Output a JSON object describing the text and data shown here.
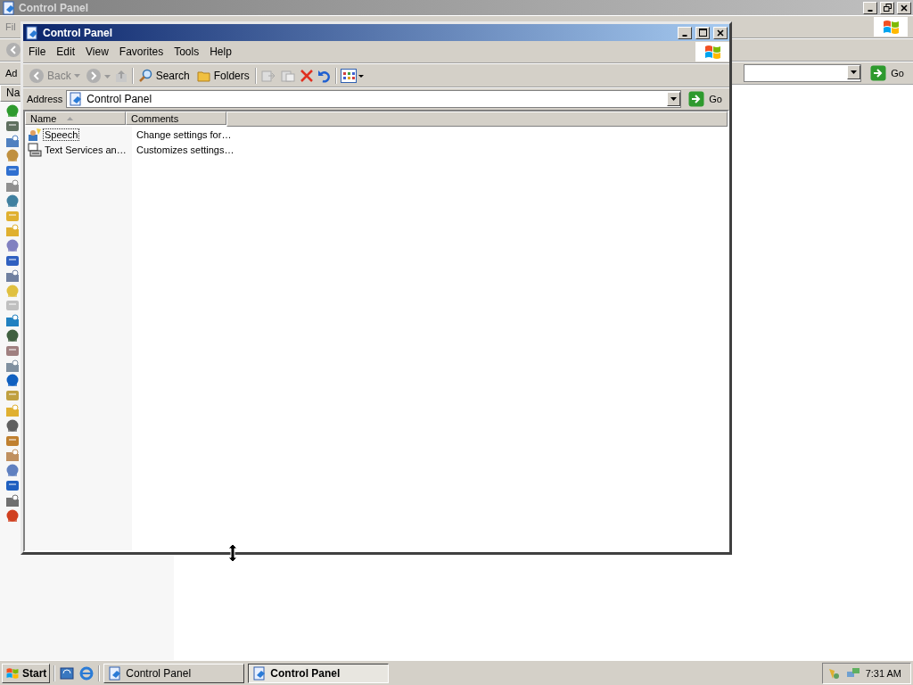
{
  "background_window": {
    "title": "Control Panel",
    "menu": [
      "Fil"
    ],
    "address_label": "Ad",
    "go": "Go",
    "column_header": "Na"
  },
  "window": {
    "title": "Control Panel",
    "menu": [
      "File",
      "Edit",
      "View",
      "Favorites",
      "Tools",
      "Help"
    ],
    "toolbar": {
      "back": "Back",
      "search": "Search",
      "folders": "Folders"
    },
    "address": {
      "label": "Address",
      "value": "Control Panel",
      "go": "Go"
    },
    "columns": [
      {
        "label": "Name",
        "sorted": true
      },
      {
        "label": "Comments",
        "sorted": false
      }
    ],
    "rows": [
      {
        "name": "Speech",
        "comment": "Change settings for…",
        "focused": true,
        "kind": "speech"
      },
      {
        "name": "Text Services an…",
        "comment": "Customizes settings…",
        "focused": false,
        "kind": "keyboard"
      }
    ]
  },
  "taskbar": {
    "start": "Start",
    "tasks": [
      {
        "label": "Control Panel",
        "selected": false
      },
      {
        "label": "Control Panel",
        "selected": true
      }
    ],
    "clock": "7:31 AM"
  }
}
